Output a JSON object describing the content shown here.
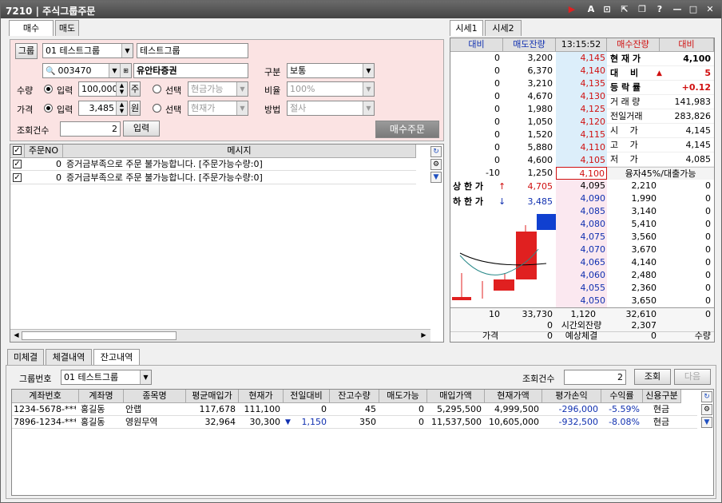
{
  "window": {
    "code": "7210",
    "title": "주식그룹주문"
  },
  "titlebar_icons": [
    "record-icon",
    "text-icon",
    "link-icon",
    "export-icon",
    "restore-icon",
    "help-icon",
    "minimize-icon",
    "maximize-icon",
    "close-icon"
  ],
  "order": {
    "tabs": [
      "매수",
      "매도"
    ],
    "group_label": "그룹",
    "group_value": "01 테스트그룹",
    "group_name": "테스트그룹",
    "code_value": "003470",
    "stock_name": "유안타증권",
    "type_label": "구분",
    "type_value": "보통",
    "qty_label": "수량",
    "qty_input_label": "입력",
    "qty_value": "100,000",
    "qty_unit": "주",
    "qty_select_label": "선택",
    "qty_select_value": "현금가능",
    "ratio_label": "비율",
    "ratio_value": "100%",
    "price_label": "가격",
    "price_input_label": "입력",
    "price_value": "3,485",
    "price_unit": "원",
    "price_select_label": "선택",
    "price_select_value": "현재가",
    "method_label": "방법",
    "method_value": "절사",
    "count_label": "조회건수",
    "count_value": "2",
    "input_button": "입력",
    "submit_button": "매수주문"
  },
  "messages": {
    "headers": [
      "주문NO",
      "메시지"
    ],
    "rows": [
      {
        "no": "0",
        "msg": "증거금부족으로 주문 불가능합니다. [주문가능수량:0]"
      },
      {
        "no": "0",
        "msg": "증거금부족으로 주문 불가능합니다. [주문가능수량:0]"
      }
    ]
  },
  "quote": {
    "tabs": [
      "시세1",
      "시세2"
    ],
    "headers": [
      "대비",
      "매도잔량",
      "13:15:52",
      "매수잔량",
      "대비"
    ],
    "asks": [
      {
        "diff": "0",
        "qty": "3,200",
        "price": "4,145"
      },
      {
        "diff": "0",
        "qty": "6,370",
        "price": "4,140"
      },
      {
        "diff": "0",
        "qty": "3,210",
        "price": "4,135"
      },
      {
        "diff": "0",
        "qty": "4,670",
        "price": "4,130"
      },
      {
        "diff": "0",
        "qty": "1,980",
        "price": "4,125"
      },
      {
        "diff": "0",
        "qty": "1,050",
        "price": "4,120"
      },
      {
        "diff": "0",
        "qty": "1,520",
        "price": "4,115"
      },
      {
        "diff": "0",
        "qty": "5,880",
        "price": "4,110"
      },
      {
        "diff": "0",
        "qty": "4,600",
        "price": "4,105"
      },
      {
        "diff": "-10",
        "qty": "1,250",
        "price": "4,100"
      }
    ],
    "info": [
      {
        "label": "현 재 가",
        "value": "4,100"
      },
      {
        "label": "대　 비",
        "value": "5",
        "arrow": "▲"
      },
      {
        "label": "등 락 률",
        "value": "+0.12"
      },
      {
        "label": "거 래 량",
        "value": "141,983"
      },
      {
        "label": "전일거래",
        "value": "283,826"
      },
      {
        "label": "시　 가",
        "value": "4,145"
      },
      {
        "label": "고　 가",
        "value": "4,145"
      },
      {
        "label": "저　 가",
        "value": "4,085"
      }
    ],
    "margin_text": "융자45%/대출가능",
    "upper_label": "상 한 가",
    "upper_arrow": "↑",
    "upper_value": "4,705",
    "lower_label": "하 한 가",
    "lower_arrow": "↓",
    "lower_value": "3,485",
    "bids": [
      {
        "price": "4,095",
        "qty": "2,210",
        "diff": "0"
      },
      {
        "price": "4,090",
        "qty": "1,990",
        "diff": "0"
      },
      {
        "price": "4,085",
        "qty": "3,140",
        "diff": "0"
      },
      {
        "price": "4,080",
        "qty": "5,410",
        "diff": "0"
      },
      {
        "price": "4,075",
        "qty": "3,560",
        "diff": "0"
      },
      {
        "price": "4,070",
        "qty": "3,670",
        "diff": "0"
      },
      {
        "price": "4,065",
        "qty": "4,140",
        "diff": "0"
      },
      {
        "price": "4,060",
        "qty": "2,480",
        "diff": "0"
      },
      {
        "price": "4,055",
        "qty": "2,360",
        "diff": "0"
      },
      {
        "price": "4,050",
        "qty": "3,650",
        "diff": "0"
      }
    ],
    "total": {
      "ask_diff": "10",
      "ask_qty": "33,730",
      "mid": "1,120",
      "bid_qty": "32,610",
      "bid_diff": "0"
    },
    "after": {
      "left": "0",
      "label": "시간외잔량",
      "right": "2,307"
    },
    "footer": {
      "c1": "가격",
      "c2": "0",
      "c3": "예상체결",
      "c4": "0",
      "c5": "수량"
    }
  },
  "holdings": {
    "tabs": [
      "미체결",
      "체결내역",
      "잔고내역"
    ],
    "group_label": "그룹번호",
    "group_value": "01 테스트그룹",
    "count_label": "조회건수",
    "count_value": "2",
    "search_button": "조회",
    "next_button": "다음",
    "headers": [
      "계좌번호",
      "계좌명",
      "종목명",
      "평균매입가",
      "현재가",
      "전일대비",
      "잔고수량",
      "매도가능",
      "매입가액",
      "현재가액",
      "평가손익",
      "수익률",
      "신용구분"
    ],
    "rows": [
      {
        "acct": "1234-5678-****",
        "name": "홍길동",
        "stock": "안랩",
        "avg": "117,678",
        "cur": "111,100",
        "arrow": "",
        "diff": "0",
        "qty": "45",
        "sell": "0",
        "buy_amt": "5,295,500",
        "cur_amt": "4,999,500",
        "pl": "-296,000",
        "rate": "-5.59%",
        "credit": "현금"
      },
      {
        "acct": "7896-1234-****",
        "name": "홍길동",
        "stock": "영원무역",
        "avg": "32,964",
        "cur": "30,300",
        "arrow": "▼",
        "diff": "1,150",
        "qty": "350",
        "sell": "0",
        "buy_amt": "11,537,500",
        "cur_amt": "10,605,000",
        "pl": "-932,500",
        "rate": "-8.08%",
        "credit": "현금"
      }
    ]
  }
}
